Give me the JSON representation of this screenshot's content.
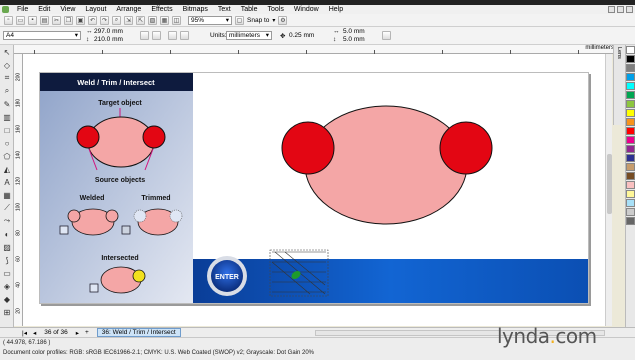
{
  "menubar": {
    "items": [
      "File",
      "Edit",
      "View",
      "Layout",
      "Arrange",
      "Effects",
      "Bitmaps",
      "Text",
      "Table",
      "Tools",
      "Window",
      "Help"
    ]
  },
  "toolbar": {
    "zoom_value": "95%",
    "snap_label": "Snap to"
  },
  "propbar": {
    "page_size": "A4",
    "width": "297.0 mm",
    "height": "210.0 mm",
    "units_label": "Units:",
    "units_value": "millimeters",
    "nudge": "0.25 mm",
    "dup_x": "5.0 mm",
    "dup_y": "5.0 mm"
  },
  "ruler": {
    "units": "millimeters",
    "h_ticks": [
      "-50",
      "0",
      "50",
      "100",
      "150",
      "200",
      "250",
      "300",
      "350"
    ],
    "v_ticks": [
      "200",
      "180",
      "160",
      "140",
      "120",
      "100",
      "80",
      "60",
      "40",
      "20"
    ]
  },
  "slide": {
    "header": "Weld / Trim / Intersect",
    "target_label": "Target object",
    "source_label": "Source objects",
    "welded_label": "Welded",
    "trimmed_label": "Trimmed",
    "intersected_label": "Intersected",
    "enter_label": "ENTER"
  },
  "pager": {
    "count": "36 of 36",
    "tab": "36: Weld / Trim / Intersect"
  },
  "status": {
    "coords": "( 44.978, 67.186 )",
    "profiles": "Document color profiles: RGB: sRGB IEC61966-2.1; CMYK: U.S. Web Coated (SWOP) v2; Grayscale: Dot Gain 20%"
  },
  "branding": {
    "logo": "lynda.com"
  },
  "colors": {
    "pink_fill": "#f4a6a6",
    "red_fill": "#e30613",
    "header_bg": "#0e1b3e",
    "banner_blue": "#0b4fb3",
    "accent_yellow": "#f2b01e"
  },
  "palette": [
    "#ffffff",
    "#000000",
    "#7f7f7f",
    "#00a0e9",
    "#00ffff",
    "#00a651",
    "#8dc63f",
    "#ffff00",
    "#f7941d",
    "#ff0000",
    "#ec008c",
    "#92278f",
    "#2e3192",
    "#c69c6d",
    "#754c24",
    "#f9c0c0",
    "#fff799",
    "#a8e0f7",
    "#cccccc",
    "#666666"
  ]
}
